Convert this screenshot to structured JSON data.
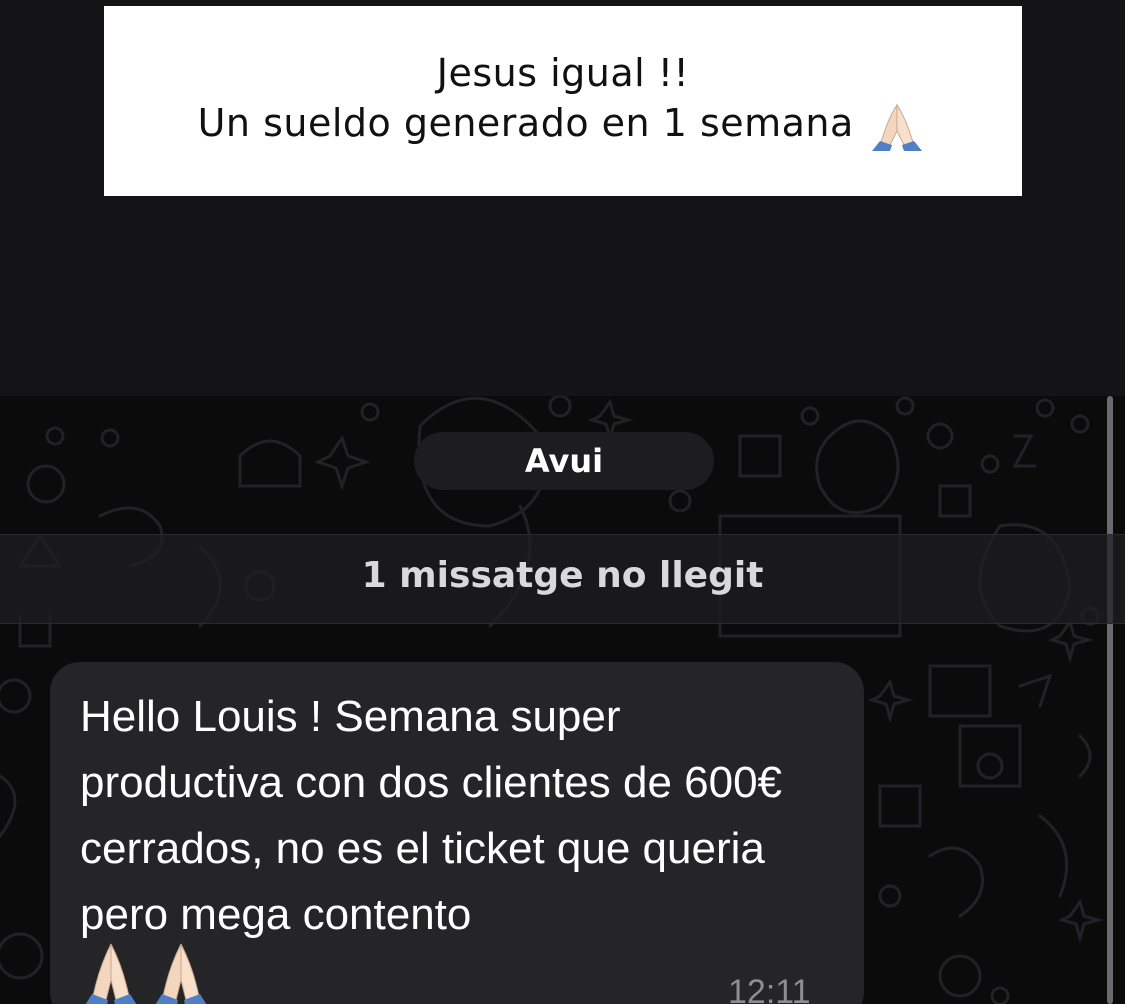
{
  "caption": {
    "line1": "Jesus igual !!",
    "line2": "Un sueldo generado en 1 semana",
    "line2_emoji": "folded-hands-icon"
  },
  "chat": {
    "date_label": "Avui",
    "unread_label": "1 missatge no llegit",
    "message": {
      "text": "Hello Louis ! Semana super productiva con dos clientes de 600€ cerrados, no es el ticket que queria pero mega contento",
      "emojis": [
        "folded-hands-icon",
        "folded-hands-icon"
      ],
      "time": "12:11"
    }
  },
  "colors": {
    "background": "#141416",
    "bubble": "#252528",
    "chip": "#1d1d20",
    "timestamp": "#8d8d92"
  }
}
